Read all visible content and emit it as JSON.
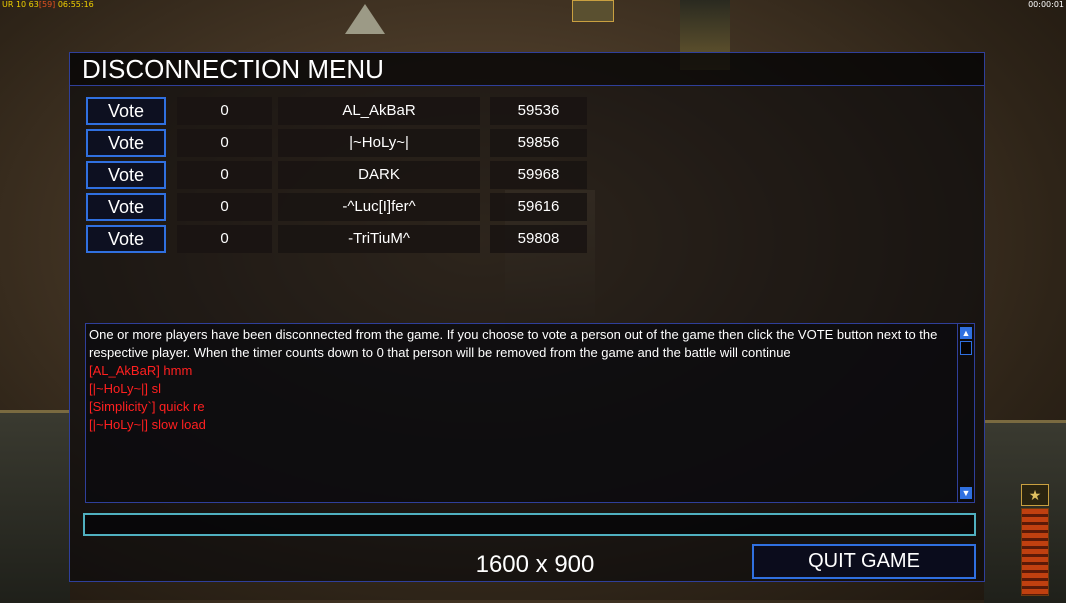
{
  "status": {
    "top_left_prefix": "UR 10 63",
    "top_left_bracket": "[59]",
    "top_left_time": "06:55:16",
    "top_right_time": "00:00:01"
  },
  "menu": {
    "title": "DISCONNECTION MENU",
    "vote_label": "Vote",
    "players": [
      {
        "votes": "0",
        "name": "AL_AkBaR",
        "ping": "59536"
      },
      {
        "votes": "0",
        "name": "|~HoLy~|",
        "ping": "59856"
      },
      {
        "votes": "0",
        "name": "DARK",
        "ping": "59968"
      },
      {
        "votes": "0",
        "name": "-^Luc[I]fer^",
        "ping": "59616"
      },
      {
        "votes": "0",
        "name": "-TriTiuM^",
        "ping": "59808"
      }
    ],
    "messages": {
      "system": "One or more players have been disconnected from the game. If you choose to vote a person out of the game then click the VOTE button next to the respective player. When the timer counts down to 0 that person will be removed from the game and the battle will continue",
      "chat": [
        "[AL_AkBaR] hmm",
        "[|~HoLy~|] sl",
        "[Simplicity`] quick re",
        "[|~HoLy~|] slow load"
      ]
    },
    "chat_input_value": "",
    "resolution_label": "1600 x 900",
    "quit_label": "QUIT GAME"
  },
  "colors": {
    "accent_blue": "#3070e0",
    "chat_red": "#ff2020",
    "input_border": "#50b0c0"
  }
}
